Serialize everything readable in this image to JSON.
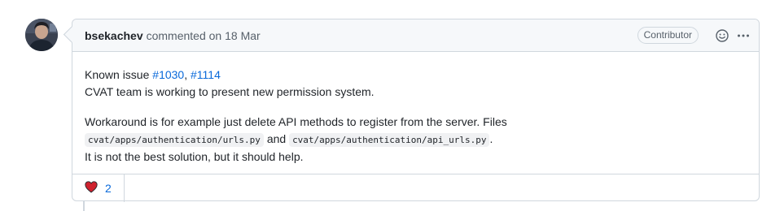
{
  "comment": {
    "author": "bsekachev",
    "action": "commented on",
    "date": "18 Mar",
    "role": "Contributor",
    "icons": {
      "emoji": "smiley-icon",
      "more": "kebab-horizontal-icon"
    },
    "body": {
      "line1_prefix": "Known issue",
      "issue_link_1": "#1030",
      "separator": ",",
      "issue_link_2": "#1114",
      "line2": "CVAT team is working to present new permission system.",
      "workaround": "Workaround is for example just delete API methods to register from the server. Files",
      "code_1": "cvat/apps/authentication/urls.py",
      "and": "and",
      "code_2": "cvat/apps/authentication/api_urls.py",
      "period": ".",
      "closing": "It is not the best solution, but it should help."
    },
    "reactions": [
      {
        "icon": "heart-icon",
        "count": "2"
      }
    ]
  },
  "colors": {
    "link": "#0969da",
    "border": "#d0d7de",
    "header_bg": "#f6f8fa",
    "heart": "#cf222e"
  }
}
